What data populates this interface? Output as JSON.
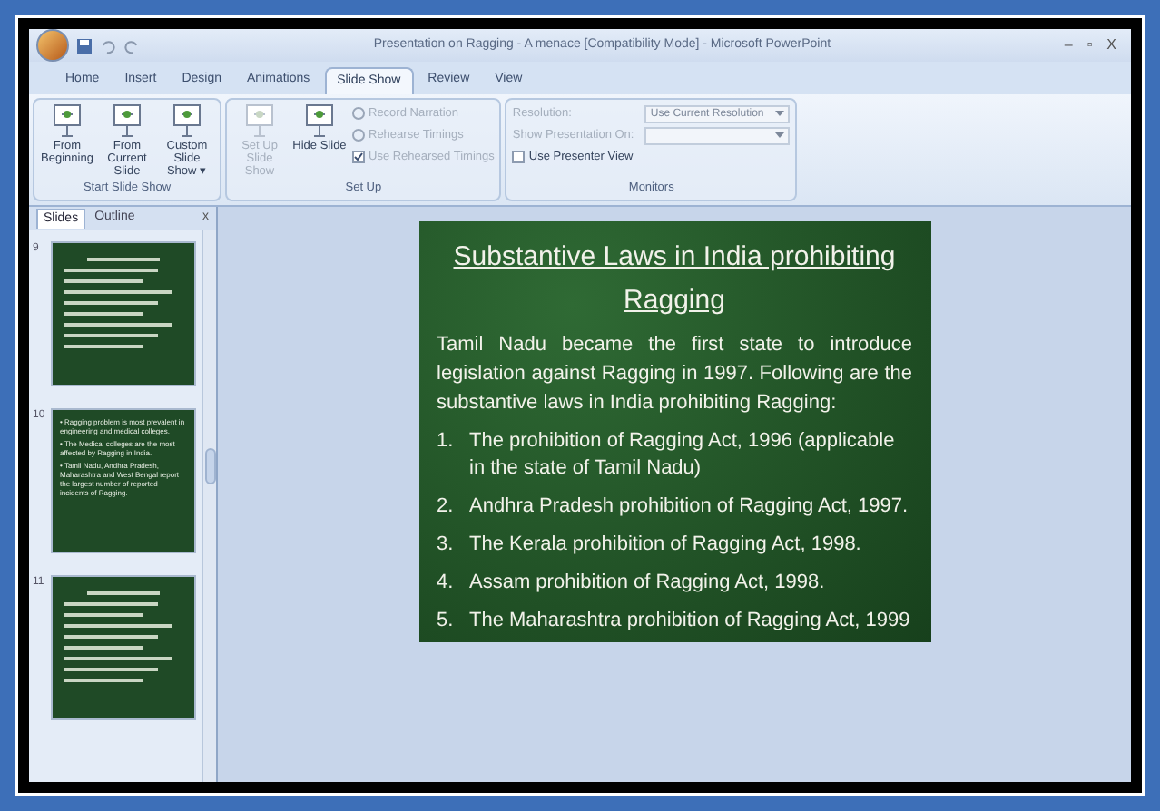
{
  "window": {
    "title": "Presentation on Ragging - A menace [Compatibility Mode] - Microsoft PowerPoint",
    "controls": [
      "–",
      "▫",
      "X"
    ]
  },
  "ribbon": {
    "tabs": [
      {
        "label": "Home",
        "selected": false
      },
      {
        "label": "Insert",
        "selected": false
      },
      {
        "label": "Design",
        "selected": false
      },
      {
        "label": "Animations",
        "selected": false
      },
      {
        "label": "Slide Show",
        "selected": true
      },
      {
        "label": "Review",
        "selected": false
      },
      {
        "label": "View",
        "selected": false
      }
    ],
    "groups": [
      {
        "label": "Start Slide Show",
        "items": [
          {
            "kind": "large",
            "label": "From Beginning",
            "disabled": false
          },
          {
            "kind": "large",
            "label": "From Current Slide",
            "disabled": false
          },
          {
            "kind": "large",
            "label": "Custom Slide Show ▾",
            "disabled": false
          }
        ]
      },
      {
        "label": "Set Up",
        "items": [
          {
            "kind": "large",
            "label": "Set Up Slide Show",
            "disabled": true
          },
          {
            "kind": "large",
            "label": "Hide Slide",
            "disabled": false
          },
          {
            "kind": "small",
            "label": "Record Narration",
            "disabled": true
          },
          {
            "kind": "small",
            "label": "Rehearse Timings",
            "disabled": true
          },
          {
            "kind": "check",
            "label": "Use Rehearsed Timings",
            "checked": true,
            "disabled": true
          }
        ]
      },
      {
        "label": "Monitors",
        "items": [
          {
            "kind": "select",
            "label": "Resolution:",
            "value": "Use Current Resolution",
            "disabled": true
          },
          {
            "kind": "select",
            "label": "Show Presentation On:",
            "disabled": true
          },
          {
            "kind": "check",
            "label": "Use Presenter View",
            "checked": false,
            "disabled": false
          }
        ]
      }
    ]
  },
  "side_panel": {
    "tabs": [
      {
        "label": "Slides",
        "selected": true
      },
      {
        "label": "Outline",
        "selected": false
      }
    ],
    "close": "x",
    "slides": [
      {
        "number": "9"
      },
      {
        "number": "10",
        "lines": [
          "• Ragging problem is most prevalent in engineering and medical colleges.",
          "• The Medical colleges are the most affected by Ragging in India.",
          "• Tamil Nadu, Andhra Pradesh, Maharashtra and West Bengal report the largest number of reported incidents of Ragging."
        ]
      },
      {
        "number": "11"
      }
    ]
  },
  "slide": {
    "title": "Substantive Laws in India prohibiting Ragging",
    "intro": "Tamil Nadu became the first state to introduce legislation against Ragging in 1997. Following are the substantive laws in India prohibiting Ragging:",
    "items": [
      {
        "number": "1.",
        "text": "The prohibition of Ragging Act, 1996 (applicable in the state of Tamil Nadu)"
      },
      {
        "number": "2.",
        "text": "Andhra Pradesh prohibition of Ragging Act, 1997."
      },
      {
        "number": "3.",
        "text": "The Kerala prohibition of Ragging Act, 1998."
      },
      {
        "number": "4.",
        "text": "Assam prohibition of Ragging Act, 1998."
      },
      {
        "number": "5.",
        "text": "The Maharashtra prohibition of Ragging Act, 1999"
      }
    ]
  }
}
